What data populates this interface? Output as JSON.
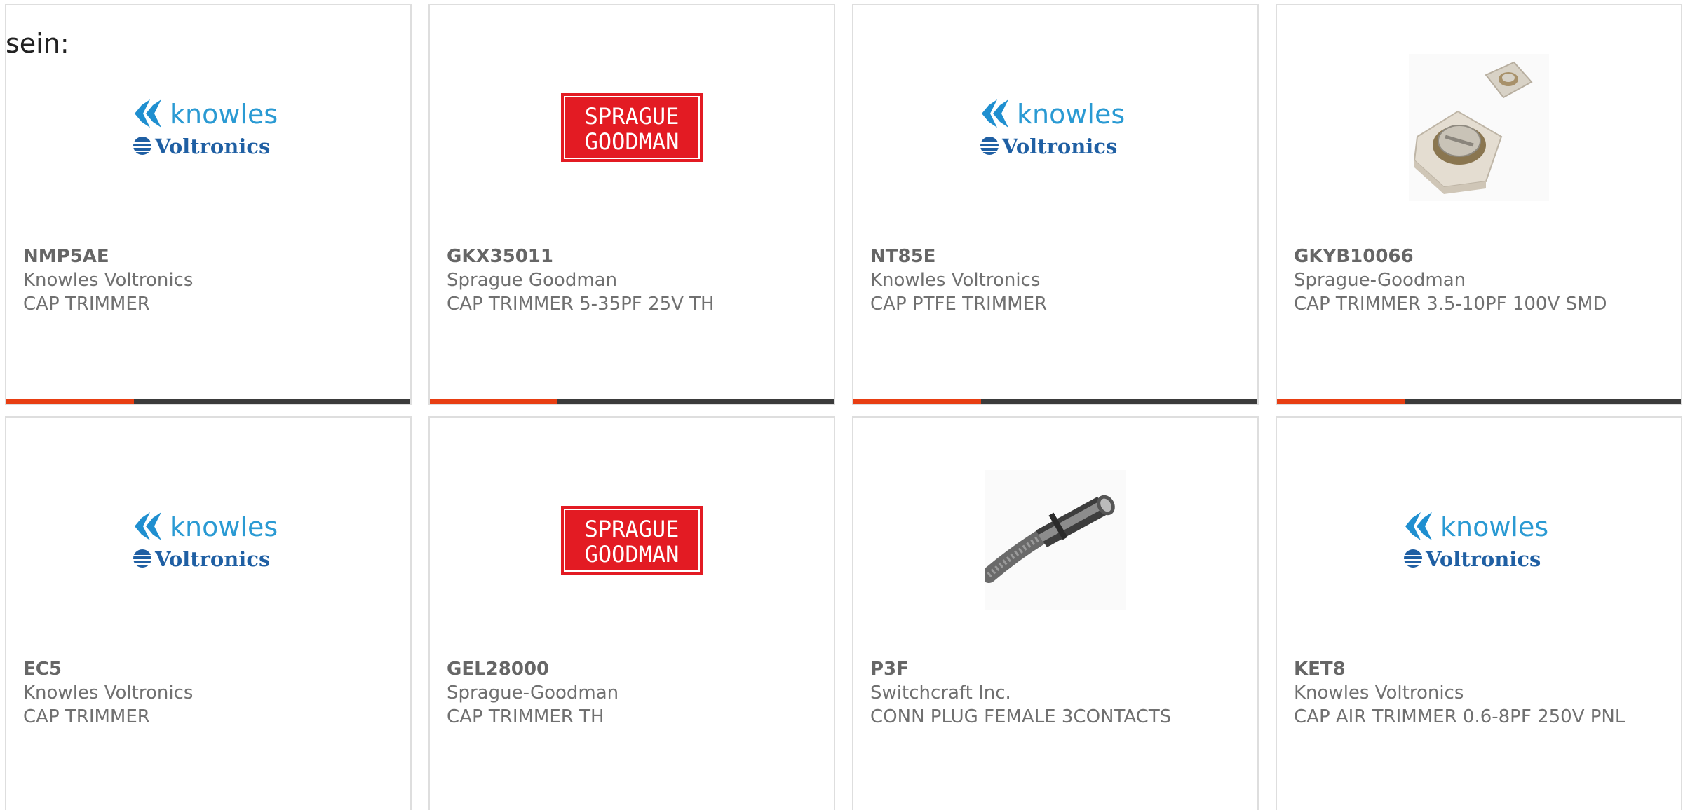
{
  "intro_text": "sein:",
  "colors": {
    "accent": "#e83e12",
    "bar_dark": "#3b3b3b",
    "knowles_blue": "#2a9ad3",
    "voltronics_blue": "#1f5fa3",
    "sprague_red": "#e31b23"
  },
  "products": [
    {
      "part": "NMP5AE",
      "manufacturer": "Knowles Voltronics",
      "description": "CAP TRIMMER",
      "image": "knowles-voltronics-logo",
      "logo": {
        "top": "knowles",
        "bottom": "Voltronics"
      }
    },
    {
      "part": "GKX35011",
      "manufacturer": "Sprague Goodman",
      "description": "CAP TRIMMER 5-35PF 25V TH",
      "image": "sprague-goodman-logo",
      "logo": {
        "top": "SPRAGUE",
        "bottom": "GOODMAN"
      }
    },
    {
      "part": "NT85E",
      "manufacturer": "Knowles Voltronics",
      "description": "CAP PTFE TRIMMER",
      "image": "knowles-voltronics-logo",
      "logo": {
        "top": "knowles",
        "bottom": "Voltronics"
      }
    },
    {
      "part": "GKYB10066",
      "manufacturer": "Sprague-Goodman",
      "description": "CAP TRIMMER 3.5-10PF 100V SMD",
      "image": "smd-trimmer-photo",
      "logo": {
        "top": "",
        "bottom": ""
      }
    },
    {
      "part": "EC5",
      "manufacturer": "Knowles Voltronics",
      "description": "CAP TRIMMER",
      "image": "knowles-voltronics-logo",
      "logo": {
        "top": "knowles",
        "bottom": "Voltronics"
      }
    },
    {
      "part": "GEL28000",
      "manufacturer": "Sprague-Goodman",
      "description": "CAP TRIMMER TH",
      "image": "sprague-goodman-logo",
      "logo": {
        "top": "SPRAGUE",
        "bottom": "GOODMAN"
      }
    },
    {
      "part": "P3F",
      "manufacturer": "Switchcraft Inc.",
      "description": "CONN PLUG FEMALE 3CONTACTS",
      "image": "connector-plug-photo",
      "logo": {
        "top": "",
        "bottom": ""
      }
    },
    {
      "part": "KET8",
      "manufacturer": "Knowles Voltronics",
      "description": "CAP AIR TRIMMER 0.6-8PF 250V PNL",
      "image": "knowles-voltronics-logo",
      "logo": {
        "top": "knowles",
        "bottom": "Voltronics"
      }
    }
  ]
}
